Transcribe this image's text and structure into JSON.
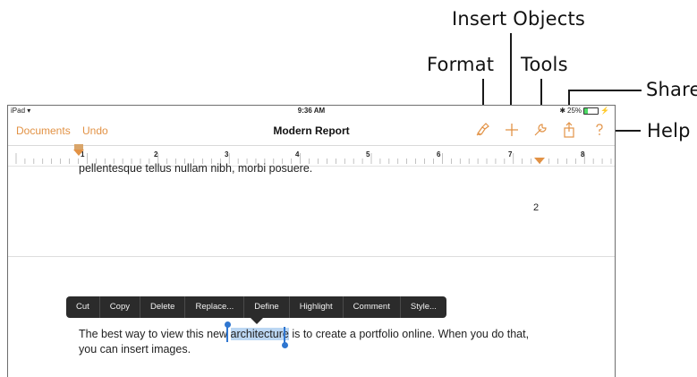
{
  "callouts": {
    "insert_objects": "Insert Objects",
    "format": "Format",
    "tools": "Tools",
    "share": "Share",
    "help": "Help"
  },
  "status_bar": {
    "device": "iPad",
    "time": "9:36 AM",
    "battery": "25%",
    "battery_level": 0.25
  },
  "toolbar": {
    "documents_label": "Documents",
    "undo_label": "Undo",
    "title": "Modern Report",
    "icons": [
      "format-icon",
      "insert-objects-icon",
      "tools-icon",
      "share-icon",
      "help-icon"
    ]
  },
  "ruler": {
    "numbers": [
      "1",
      "2",
      "3",
      "4",
      "5",
      "6",
      "7",
      "8"
    ]
  },
  "document": {
    "prev_text": "pellentesque tellus nullam nibh, morbi posuere.",
    "page_number": "2",
    "line1_before": "The best way to view this new ",
    "line1_selected": "architecture",
    "line1_after": " is to create a portfolio online. When you do that,",
    "line2": "you can insert images."
  },
  "context_menu": {
    "items": [
      "Cut",
      "Copy",
      "Delete",
      "Replace...",
      "Define",
      "Highlight",
      "Comment",
      "Style..."
    ]
  },
  "colors": {
    "accent": "#e29245",
    "selection": "#bcd7f3",
    "handle": "#2f76d0",
    "menu_bg": "#2b2b2b"
  }
}
